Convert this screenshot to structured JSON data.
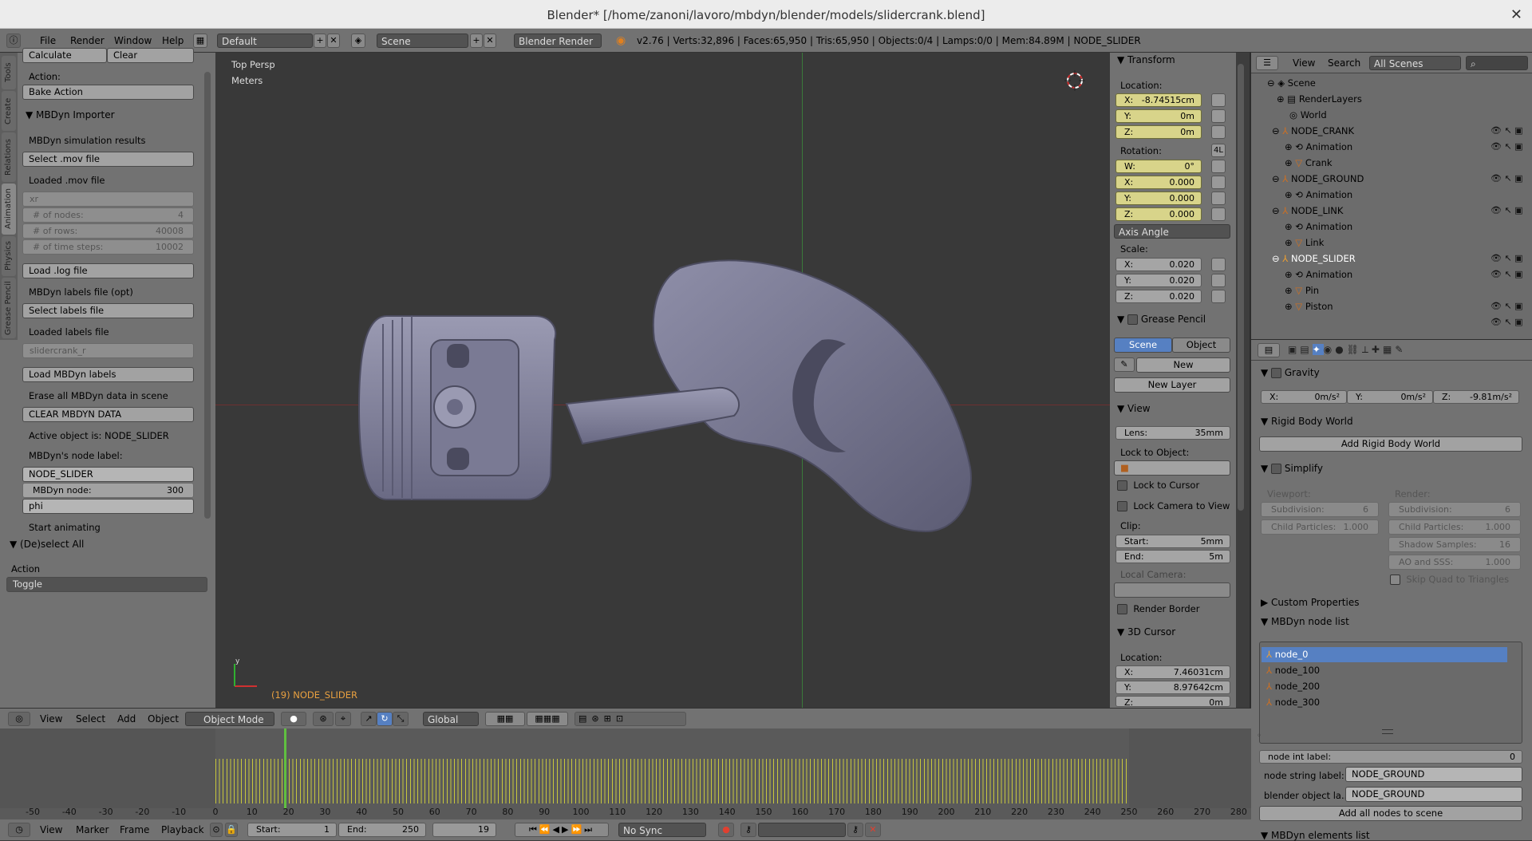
{
  "title": "Blender* [/home/zanoni/lavoro/mbdyn/blender/models/slidercrank.blend]",
  "menu": {
    "file": "File",
    "render": "Render",
    "window": "Window",
    "help": "Help"
  },
  "layout": "Default",
  "scene": "Scene",
  "engine": "Blender Render",
  "stats": "v2.76 | Verts:32,896 | Faces:65,950 | Tris:65,950 | Objects:0/4 | Lamps:0/0 | Mem:84.89M | NODE_SLIDER",
  "tabs": [
    "Tools",
    "Create",
    "Relations",
    "Animation",
    "Physics",
    "Grease Pencil"
  ],
  "tool": {
    "calculate": "Calculate",
    "clear": "Clear",
    "action_lbl": "Action:",
    "bake": "Bake Action",
    "mbdyn_hdr": "MBDyn Importer",
    "sim_results": "MBDyn simulation results",
    "select_mov": "Select .mov file",
    "loaded_mov": "Loaded .mov file",
    "xr": "xr",
    "nodes_l": "# of nodes:",
    "nodes_v": "4",
    "rows_l": "# of rows:",
    "rows_v": "40008",
    "steps_l": "# of time steps:",
    "steps_v": "10002",
    "load_log": "Load .log file",
    "labels_opt": "MBDyn labels file (opt)",
    "select_labels": "Select labels file",
    "loaded_labels": "Loaded labels file",
    "labels_file": "slidercrank_r",
    "load_labels": "Load MBDyn labels",
    "erase": "Erase all MBDyn data in scene",
    "clear_data": "CLEAR MBDYN DATA",
    "active": "Active object is: NODE_SLIDER",
    "node_label": "MBDyn's node label:",
    "node_slider": "NODE_SLIDER",
    "node_l": "MBDyn node:",
    "node_v": "300",
    "phi": "phi",
    "start_anim": "Start animating",
    "deselect_hdr": "(De)select All",
    "action2": "Action",
    "toggle": "Toggle"
  },
  "viewport": {
    "persp": "Top Persp",
    "units": "Meters",
    "obj": "(19) NODE_SLIDER"
  },
  "npanel": {
    "transform": "Transform",
    "location": "Location:",
    "lx": "X:",
    "lxv": "-8.74515cm",
    "ly": "Y:",
    "lyv": "0m",
    "lz": "Z:",
    "lzv": "0m",
    "rotation": "Rotation:",
    "rot_mode": "4L",
    "rw": "W:",
    "rwv": "0°",
    "rx": "X:",
    "rxv": "0.000",
    "ry": "Y:",
    "ryv": "0.000",
    "rz": "Z:",
    "rzv": "0.000",
    "axis_angle": "Axis Angle",
    "scale": "Scale:",
    "sx": "X:",
    "sxv": "0.020",
    "sy": "Y:",
    "syv": "0.020",
    "sz": "Z:",
    "szv": "0.020",
    "grease": "Grease Pencil",
    "gp_scene": "Scene",
    "gp_object": "Object",
    "gp_new": "New",
    "gp_layer": "New Layer",
    "view": "View",
    "lens_l": "Lens:",
    "lens_v": "35mm",
    "lock_obj": "Lock to Object:",
    "lock_cursor": "Lock to Cursor",
    "lock_cam": "Lock Camera to View",
    "clip": "Clip:",
    "cs": "Start:",
    "csv": "5mm",
    "ce": "End:",
    "cev": "5m",
    "local_cam": "Local Camera:",
    "render_border": "Render Border",
    "cursor": "3D Cursor",
    "c_loc": "Location:",
    "cx": "X:",
    "cxv": "7.46031cm",
    "cy": "Y:",
    "cyv": "8.97642cm",
    "cz": "Z:",
    "czv": "0m"
  },
  "outliner": {
    "view": "View",
    "search": "Search",
    "scenes": "All Scenes",
    "rows": [
      "Scene",
      "RenderLayers",
      "World",
      "NODE_CRANK",
      "Animation",
      "Crank",
      "NODE_GROUND",
      "Animation",
      "NODE_LINK",
      "Animation",
      "Link",
      "NODE_SLIDER",
      "Animation",
      "Pin",
      "Piston"
    ]
  },
  "props": {
    "gravity": "Gravity",
    "gx": "X:",
    "gxv": "0m/s²",
    "gy": "Y:",
    "gyv": "0m/s²",
    "gz": "Z:",
    "gzv": "-9.81m/s²",
    "rbw": "Rigid Body World",
    "add_rbw": "Add Rigid Body World",
    "simplify": "Simplify",
    "viewport": "Viewport:",
    "render": "Render:",
    "sub_l": "Subdivision:",
    "sub_v": "6",
    "cp_l": "Child Particles:",
    "cp_v": "1.000",
    "ss_l": "Shadow Samples:",
    "ss_v": "16",
    "ao_l": "AO and SSS:",
    "ao_v": "1.000",
    "skip": "Skip Quad to Triangles",
    "custom": "Custom Properties",
    "nodelist": "MBDyn node list",
    "nodes": [
      "node_0",
      "node_100",
      "node_200",
      "node_300"
    ],
    "int_l": "node int label:",
    "int_v": "0",
    "str_l": "node string label:",
    "str_v": "NODE_GROUND",
    "obj_l": "blender object la...",
    "obj_v": "NODE_GROUND",
    "add_all": "Add all nodes to scene",
    "elements": "MBDyn elements list"
  },
  "viewbar": {
    "view": "View",
    "select": "Select",
    "add": "Add",
    "object": "Object",
    "mode": "Object Mode",
    "orient": "Global"
  },
  "timeline": {
    "ticks": [
      "-50",
      "-40",
      "-30",
      "-20",
      "-10",
      "0",
      "10",
      "20",
      "30",
      "40",
      "50",
      "60",
      "70",
      "80",
      "90",
      "100",
      "110",
      "120",
      "130",
      "140",
      "150",
      "160",
      "170",
      "180",
      "190",
      "200",
      "210",
      "220",
      "230",
      "240",
      "250",
      "260",
      "270",
      "280"
    ],
    "current": 19,
    "start": 0,
    "end": 250
  },
  "tlbar": {
    "view": "View",
    "marker": "Marker",
    "frame": "Frame",
    "playback": "Playback",
    "start_l": "Start:",
    "start_v": "1",
    "end_l": "End:",
    "end_v": "250",
    "cur": "19",
    "sync": "No Sync"
  }
}
